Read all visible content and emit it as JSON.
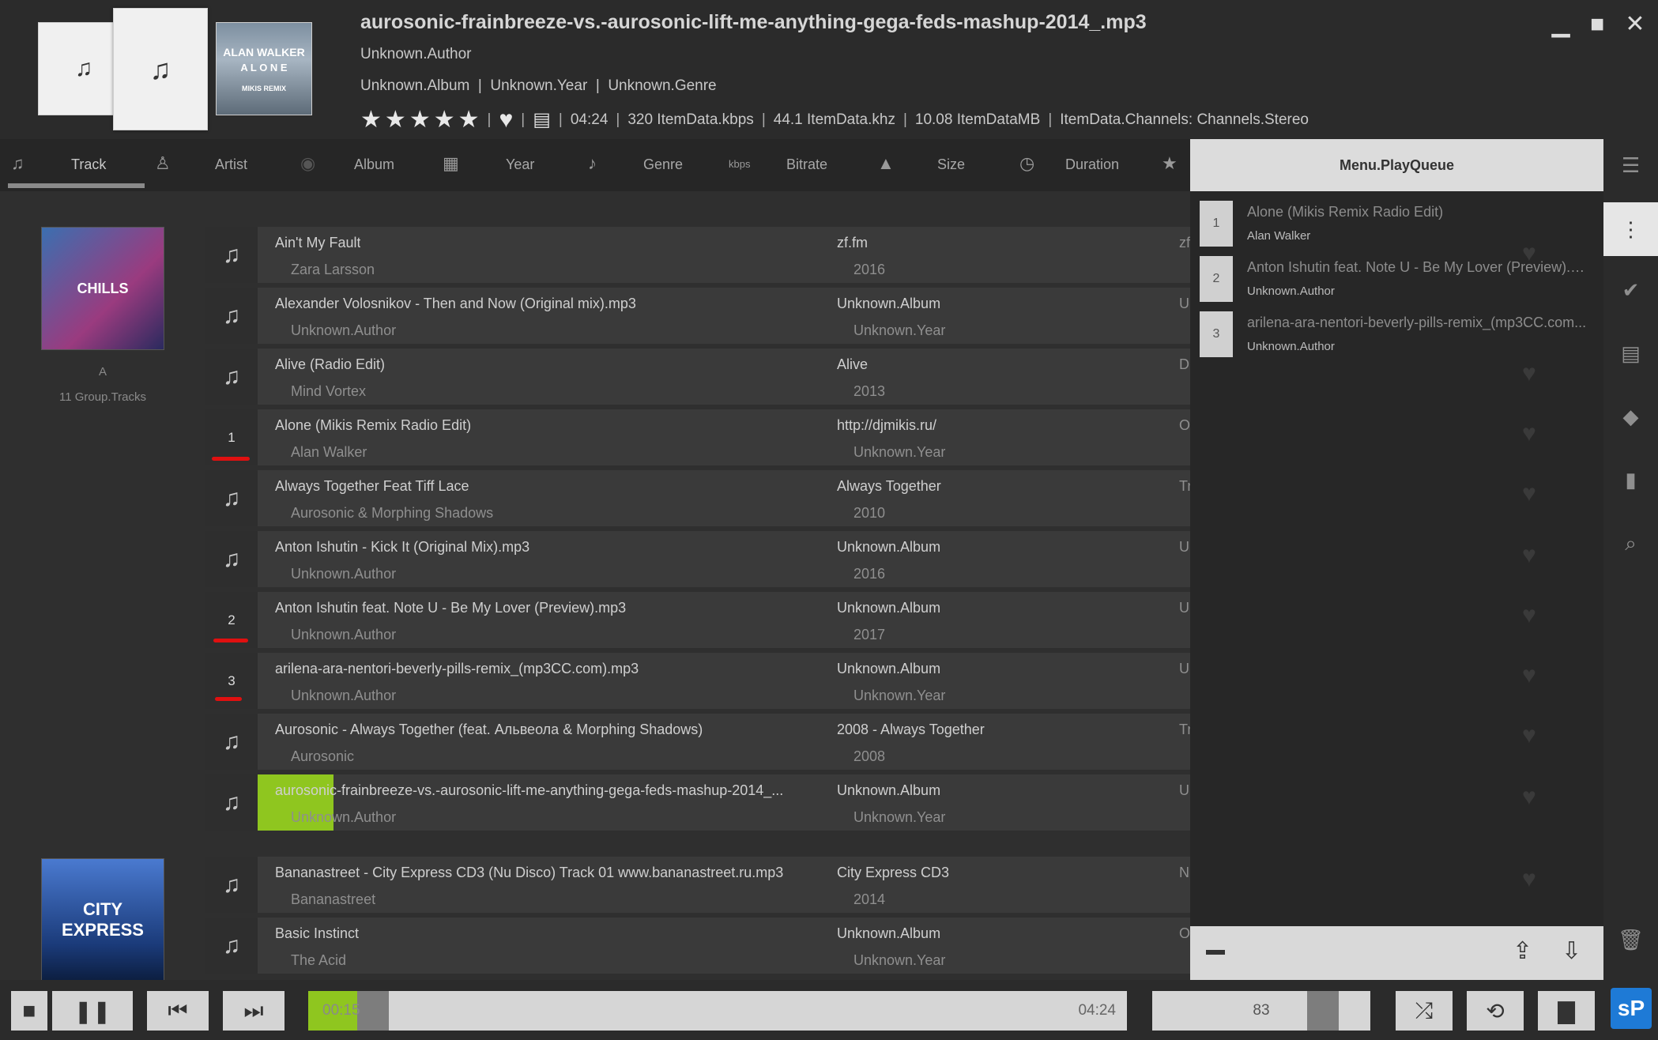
{
  "now_playing": {
    "title": "aurosonic-frainbreeze-vs.-aurosonic-lift-me-anything-gega-feds-mashup-2014_.mp3",
    "author": "Unknown.Author",
    "album_line": "Unknown.Album  |  Unknown.Year  |  Unknown.Genre",
    "duration": "04:24",
    "bitrate": "320 ItemData.kbps",
    "samplerate": "44.1 ItemData.khz",
    "size": "10.08 ItemDataMB",
    "channels": "ItemData.Channels: Channels.Stereo",
    "rating_stars": 5,
    "cover3_text": "ALAN WALKER",
    "cover3_sub": "A L O N E",
    "cover3_note": "MIKIS REMIX"
  },
  "columns": {
    "track": "Track",
    "artist": "Artist",
    "album": "Album",
    "year": "Year",
    "genre": "Genre",
    "bitrate_icon": "kbps",
    "bitrate": "Bitrate",
    "size": "Size",
    "duration": "Duration"
  },
  "groups": [
    {
      "letter": "A",
      "count": "11 Group.Tracks",
      "art_text": "CHILLS"
    },
    {
      "art_text": "CITY EXPRESS"
    }
  ],
  "tracks": [
    {
      "title": "Ain't My Fault",
      "artist": "Zara Larsson",
      "album": "zf.fm",
      "year": "2016",
      "genre": "zf",
      "queue": ""
    },
    {
      "title": "Alexander Volosnikov  - Then and Now (Original mix).mp3",
      "artist": "Unknown.Author",
      "album": "Unknown.Album",
      "year": "Unknown.Year",
      "genre": "U",
      "queue": ""
    },
    {
      "title": "Alive (Radio Edit)",
      "artist": "Mind Vortex",
      "album": "Alive",
      "year": "2013",
      "genre": "D",
      "queue": ""
    },
    {
      "title": "Alone (Mikis Remix Radio Edit)",
      "artist": "Alan Walker",
      "album": "http://djmikis.ru/",
      "year": "Unknown.Year",
      "genre": "O",
      "queue": "1"
    },
    {
      "title": "Always Together Feat Tiff Lace",
      "artist": "Aurosonic & Morphing Shadows",
      "album": "Always Together",
      "year": "2010",
      "genre": "Tr",
      "queue": ""
    },
    {
      "title": "Anton Ishutin - Kick It (Original Mix).mp3",
      "artist": "Unknown.Author",
      "album": "Unknown.Album",
      "year": "2016",
      "genre": "U",
      "queue": ""
    },
    {
      "title": "Anton Ishutin feat. Note U - Be My Lover (Preview).mp3",
      "artist": "Unknown.Author",
      "album": "Unknown.Album",
      "year": "2017",
      "genre": "U",
      "queue": "2"
    },
    {
      "title": "arilena-ara-nentori-beverly-pills-remix_(mp3CC.com).mp3",
      "artist": "Unknown.Author",
      "album": "Unknown.Album",
      "year": "Unknown.Year",
      "genre": "U",
      "queue": "3"
    },
    {
      "title": "Aurosonic - Always Together (feat. Альвеола & Morphing Shadows)",
      "artist": "Aurosonic",
      "album": "2008 - Always Together",
      "year": "2008",
      "genre": "Tr",
      "queue": ""
    },
    {
      "title": "aurosonic-frainbreeze-vs.-aurosonic-lift-me-anything-gega-feds-mashup-2014_...",
      "artist": "Unknown.Author",
      "album": "Unknown.Album",
      "year": "Unknown.Year",
      "genre": "U",
      "queue": "",
      "playing_progress": 0.054
    },
    {
      "title": "Bananastreet - City Express CD3 (Nu Disco) Track 01 www.bananastreet.ru.mp3",
      "artist": "Bananastreet",
      "album": "City Express CD3",
      "year": "2014",
      "genre": "N",
      "queue": ""
    },
    {
      "title": "Basic Instinct",
      "artist": "The Acid",
      "album": "Unknown.Album",
      "year": "Unknown.Year",
      "genre": "O",
      "queue": ""
    }
  ],
  "queue": {
    "header": "Menu.PlayQueue",
    "items": [
      {
        "n": "1",
        "title": "Alone (Mikis Remix Radio Edit)",
        "artist": "Alan Walker"
      },
      {
        "n": "2",
        "title": "Anton Ishutin feat. Note U - Be My Lover (Preview).m...",
        "artist": "Unknown.Author"
      },
      {
        "n": "3",
        "title": "arilena-ara-nentori-beverly-pills-remix_(mp3CC.com...",
        "artist": "Unknown.Author"
      }
    ]
  },
  "transport": {
    "current_time": "00:15",
    "total_time": "04:24",
    "volume": "83",
    "logo": "sP"
  },
  "colors": {
    "accent_green": "#8fc61f",
    "annotation_red": "#e01010",
    "logo_blue": "#1e7ad6"
  }
}
